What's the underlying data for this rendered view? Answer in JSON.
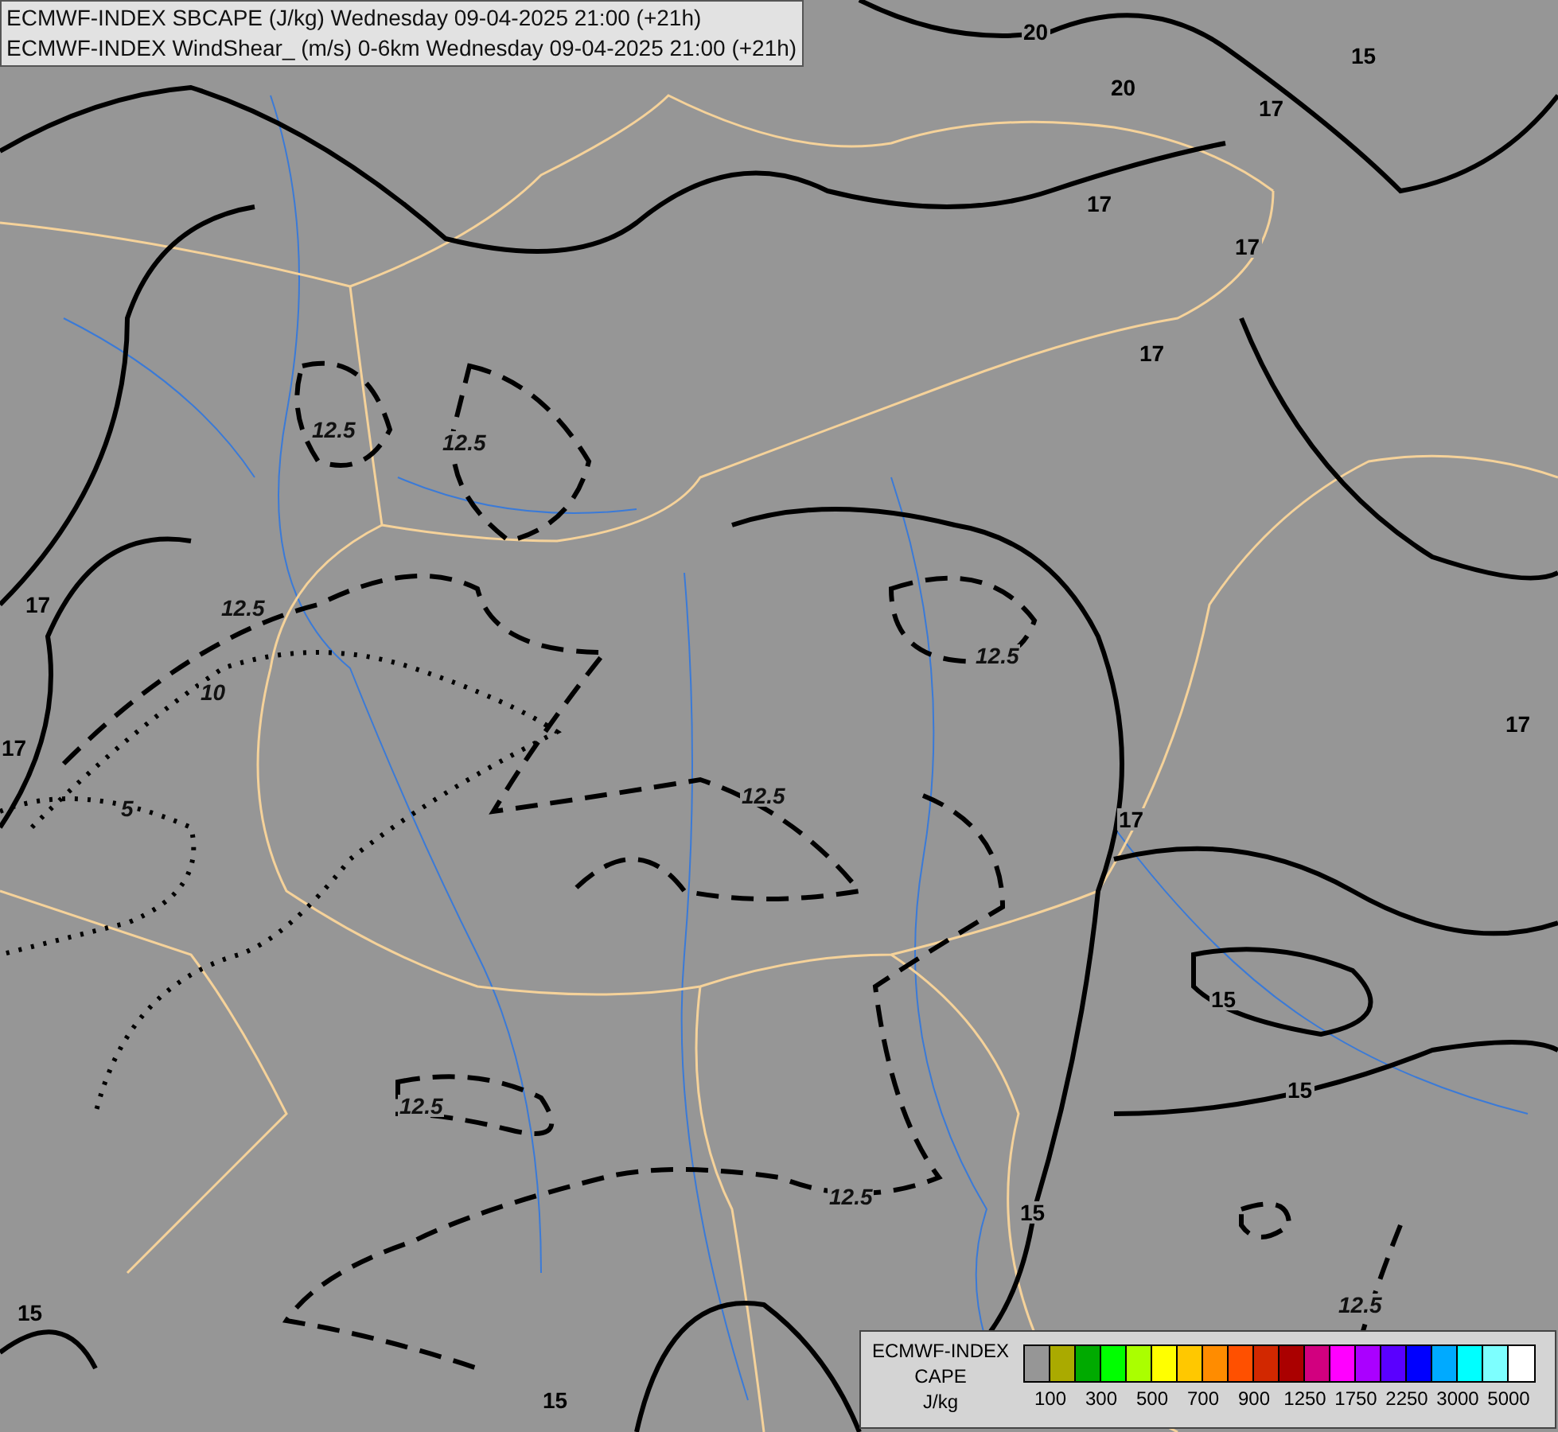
{
  "header": {
    "lines": [
      "ECMWF-INDEX SBCAPE (J/kg) Wednesday 09-04-2025 21:00 (+21h)",
      "ECMWF-INDEX WindShear_ (m/s) 0-6km Wednesday 09-04-2025 21:00 (+21h)"
    ]
  },
  "map": {
    "contour_labels": [
      {
        "text": "20",
        "kind": "solid"
      },
      {
        "text": "20",
        "kind": "solid"
      },
      {
        "text": "15",
        "kind": "solid"
      },
      {
        "text": "17",
        "kind": "solid"
      },
      {
        "text": "17",
        "kind": "solid"
      },
      {
        "text": "17",
        "kind": "solid"
      },
      {
        "text": "17",
        "kind": "solid"
      },
      {
        "text": "12.5",
        "kind": "dashed"
      },
      {
        "text": "12.5",
        "kind": "dashed"
      },
      {
        "text": "17",
        "kind": "solid"
      },
      {
        "text": "12.5",
        "kind": "dashed"
      },
      {
        "text": "10",
        "kind": "dotted"
      },
      {
        "text": "17",
        "kind": "solid"
      },
      {
        "text": "12.5",
        "kind": "dashed"
      },
      {
        "text": "12.5",
        "kind": "dashed"
      },
      {
        "text": "5",
        "kind": "dotted"
      },
      {
        "text": "17",
        "kind": "solid"
      },
      {
        "text": "17",
        "kind": "solid"
      },
      {
        "text": "15",
        "kind": "solid"
      },
      {
        "text": "15",
        "kind": "solid"
      },
      {
        "text": "12.5",
        "kind": "dashed"
      },
      {
        "text": "12.5",
        "kind": "dashed"
      },
      {
        "text": "15",
        "kind": "solid"
      },
      {
        "text": "12.5",
        "kind": "dashed"
      },
      {
        "text": "15",
        "kind": "solid"
      },
      {
        "text": "15",
        "kind": "solid"
      }
    ]
  },
  "legend": {
    "title_lines": [
      "ECMWF-INDEX",
      "CAPE",
      "J/kg"
    ],
    "swatches": [
      {
        "color": "#969696"
      },
      {
        "color": "#aaaa00"
      },
      {
        "color": "#00aa00"
      },
      {
        "color": "#00ff00"
      },
      {
        "color": "#aaff00"
      },
      {
        "color": "#ffff00"
      },
      {
        "color": "#ffc800"
      },
      {
        "color": "#ff8c00"
      },
      {
        "color": "#ff5000"
      },
      {
        "color": "#d22800"
      },
      {
        "color": "#aa0000"
      },
      {
        "color": "#d2007f"
      },
      {
        "color": "#ff00ff"
      },
      {
        "color": "#aa00ff"
      },
      {
        "color": "#5a00ff"
      },
      {
        "color": "#0000ff"
      },
      {
        "color": "#00aaff"
      },
      {
        "color": "#00ffff"
      },
      {
        "color": "#7dffff"
      },
      {
        "color": "#ffffff"
      }
    ],
    "ticks": [
      "100",
      "300",
      "500",
      "700",
      "900",
      "1250",
      "1750",
      "2250",
      "3000",
      "5000"
    ]
  }
}
